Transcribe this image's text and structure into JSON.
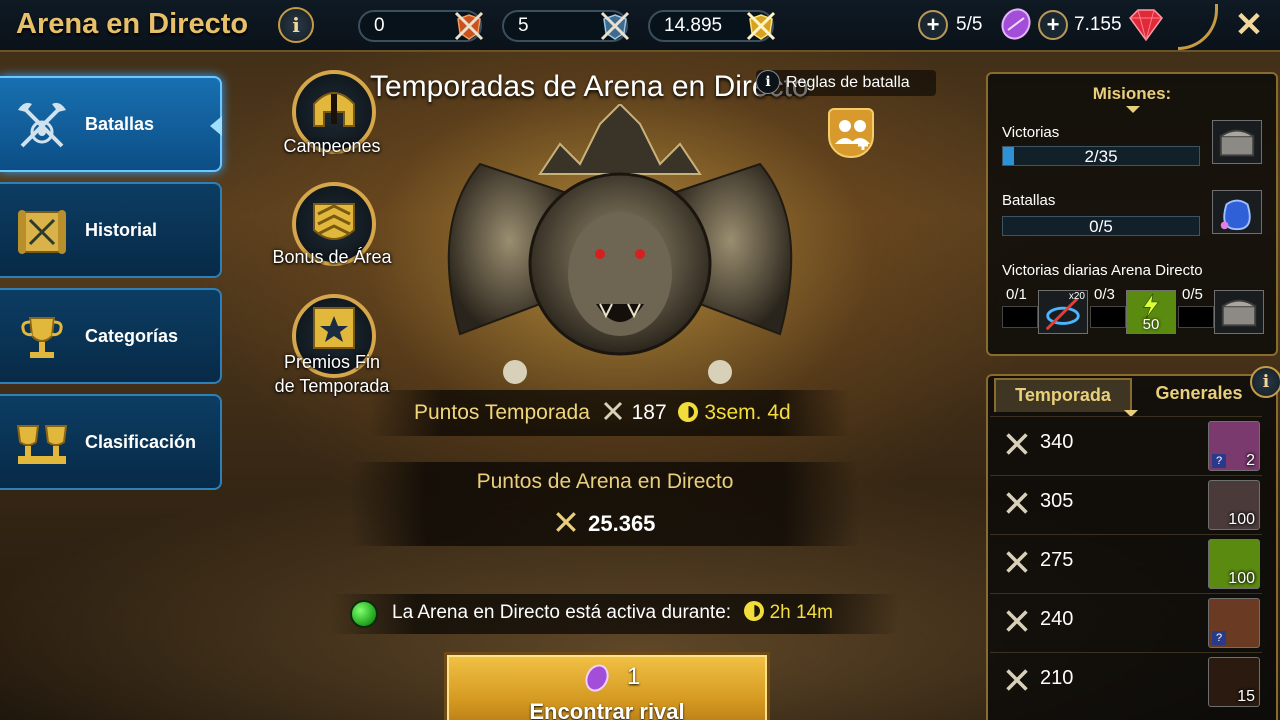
{
  "header": {
    "title": "Arena en Directo",
    "info_icon": "i",
    "counters": [
      {
        "value": "0",
        "icon": "orange-swords-shield-icon"
      },
      {
        "value": "5",
        "icon": "blue-swords-shield-icon"
      },
      {
        "value": "14.895",
        "icon": "gold-swords-shield-icon"
      }
    ],
    "tokens": "5/5",
    "gems": "7.155",
    "close_icon": "✕"
  },
  "menu": [
    {
      "label": "Batallas",
      "icon": "crossed-axes-icon",
      "active": true
    },
    {
      "label": "Historial",
      "icon": "scroll-icon",
      "active": false
    },
    {
      "label": "Categorías",
      "icon": "trophy-icon",
      "active": false
    },
    {
      "label": "Clasificación",
      "icon": "double-trophy-icon",
      "active": false
    }
  ],
  "center": {
    "title": "Temporadas de Arena en Directo",
    "rules": "Reglas de batalla",
    "side_buttons": [
      {
        "label": "Campeones"
      },
      {
        "label": "Bonus de Área"
      },
      {
        "label_line1": "Premios Fin",
        "label_line2": "de Temporada"
      }
    ],
    "season_points_label": "Puntos Temporada",
    "season_points_value": "187",
    "season_time": "3sem. 4d",
    "arena_points_label": "Puntos de Arena en Directo",
    "arena_points_value": "25.365",
    "active_text": "La Arena en Directo está activa durante:",
    "active_time": "2h 14m",
    "find_cost": "1",
    "find_label": "Encontrar rival"
  },
  "missions": {
    "title": "Misiones:",
    "victories_label": "Victorias",
    "victories_value": "2/35",
    "victories_progress": 0.057,
    "battles_label": "Batallas",
    "battles_value": "0/5",
    "battles_progress": 0,
    "daily_label": "Victorias diarias Arena Directo",
    "daily": [
      {
        "progress": "0/1",
        "reward_count": "x20"
      },
      {
        "progress": "0/3",
        "reward_count": "50"
      },
      {
        "progress": "0/5",
        "reward_count": ""
      }
    ]
  },
  "rewards": {
    "tab_season": "Temporada",
    "tab_general": "Generales",
    "info_icon": "i",
    "rows": [
      {
        "points": "340",
        "count": "2",
        "icon": "mystery-shard-icon",
        "q": true,
        "color": "#7a3a6e"
      },
      {
        "points": "305",
        "count": "100",
        "icon": "silver-pile-icon",
        "q": false,
        "color": "#4a3a3a"
      },
      {
        "points": "275",
        "count": "100",
        "icon": "energy-icon",
        "q": false,
        "color": "#5a8a10"
      },
      {
        "points": "240",
        "count": "",
        "icon": "chest-icon",
        "q": true,
        "color": "#6b3a22"
      },
      {
        "points": "210",
        "count": "15",
        "icon": "star-medal-icon",
        "q": false,
        "color": "#2a1a10"
      }
    ]
  }
}
